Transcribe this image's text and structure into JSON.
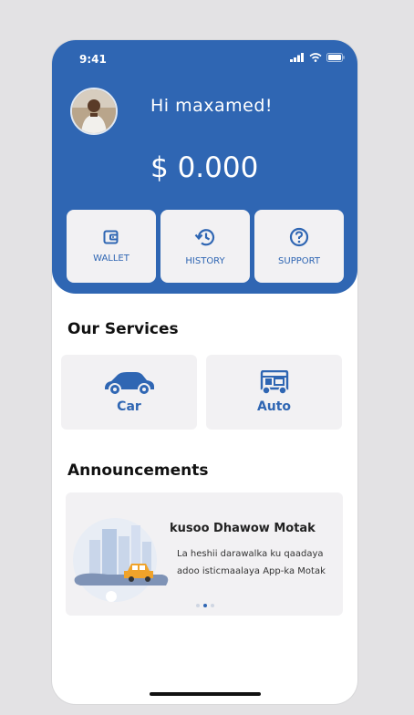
{
  "status_bar": {
    "time": "9:41"
  },
  "header": {
    "greeting": "Hi maxamed!",
    "balance": "$ 0.000"
  },
  "actions": [
    {
      "label": "WALLET",
      "icon": "wallet-icon"
    },
    {
      "label": "HISTORY",
      "icon": "history-icon"
    },
    {
      "label": "SUPPORT",
      "icon": "support-icon"
    }
  ],
  "services": {
    "title": "Our Services",
    "items": [
      {
        "label": "Car",
        "icon": "car-icon"
      },
      {
        "label": "Auto",
        "icon": "auto-rickshaw-icon"
      }
    ]
  },
  "announcements": {
    "title": "Announcements",
    "card_title": "kusoo Dhawow Motak",
    "card_body": "La heshii darawalka ku qaadaya adoo isticmaalaya App-ka Motak",
    "active_slide": 2,
    "slide_count": 3
  },
  "colors": {
    "brand": "#2f66b3",
    "card_bg": "#f2f1f3"
  }
}
